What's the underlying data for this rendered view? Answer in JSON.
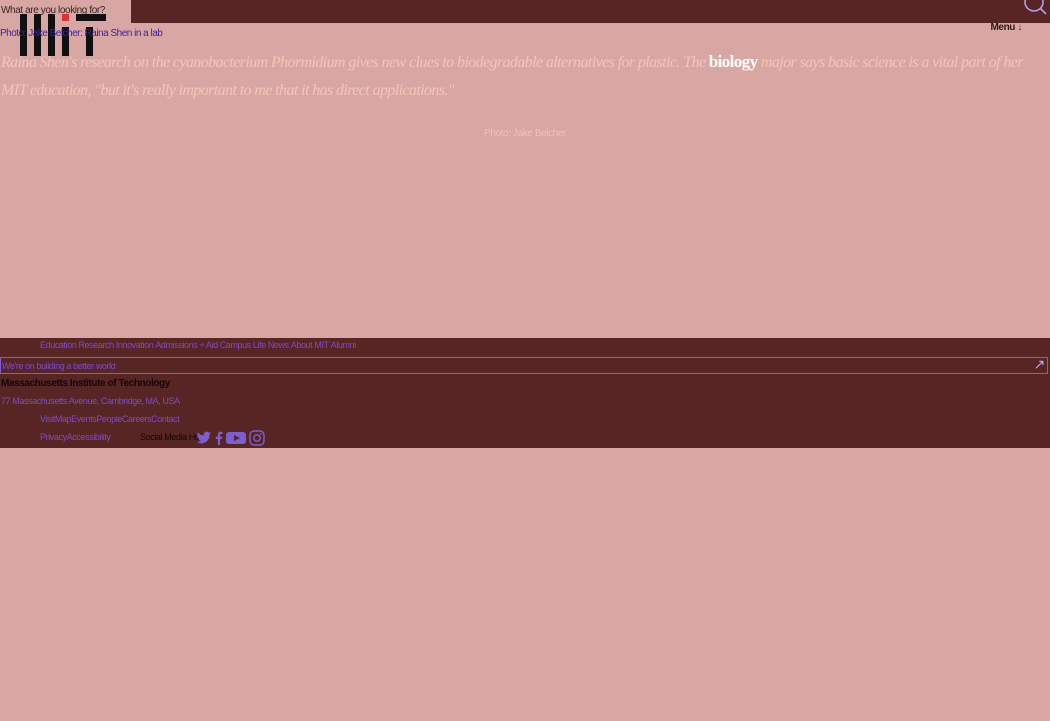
{
  "search": {
    "placeholder": "What are you looking for?"
  },
  "header": {
    "logo_alt": "MIT",
    "image_alt": "Photo: Jake Belcher: Raina Shen in a lab",
    "menu_label": "Menu",
    "menu_arrow": "↓"
  },
  "article": {
    "caption_before": "Raina Shen's research on the cyanobacterium Phormidium gives new clues to biodegradable alternatives for plastic. The",
    "caption_highlight": "biology",
    "caption_after": "major says basic science is a vital part of her MIT education, \"but it's really important to me that it has direct applications.\"",
    "photo_credit": "Photo: Jake Belcher"
  },
  "footer": {
    "nav": [
      "Education",
      "Research",
      "Innovation",
      "Admissions + Aid",
      "Campus Life",
      "News",
      "About MIT",
      "Alumni"
    ],
    "newsletter_text": "We're on building a better world",
    "newsletter_arrow": "↗",
    "institution": "Massachusetts Institute of Technology",
    "address": "77 Massachusetts Avenue, Cambridge, MA, USA",
    "links": [
      "Visit",
      "Map",
      "Events",
      "People",
      "Careers",
      "Contact"
    ],
    "links2": [
      "Privacy",
      "Accessibility"
    ],
    "social_label": "Social Media Hub",
    "social_icons": [
      "twitter-icon",
      "facebook-icon",
      "youtube-icon",
      "instagram-icon"
    ]
  },
  "colors": {
    "background": "#d9a7a3",
    "maroon": "#572524",
    "link": "#7b4bd0",
    "caption": "#f3c6b9"
  }
}
